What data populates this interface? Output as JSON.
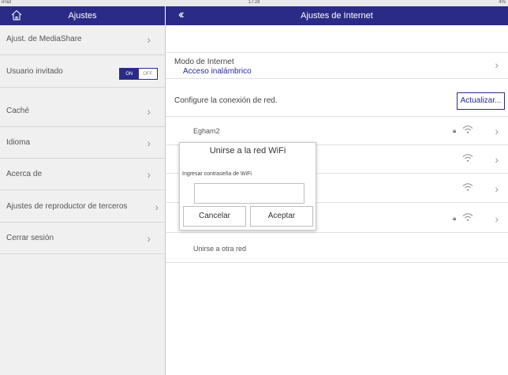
{
  "status_bar": {
    "device": "iPad",
    "time": "17:28",
    "battery": "4%"
  },
  "left_nav": {
    "title": "Ajustes"
  },
  "right_nav": {
    "title": "Ajustes de Internet"
  },
  "sidebar": {
    "items": [
      {
        "label": "Ajust. de MediaShare"
      },
      {
        "label": "Usuario invitado",
        "toggle_on": "ON",
        "toggle_off": "OFF"
      },
      {
        "label": "Caché"
      },
      {
        "label": "Idioma"
      },
      {
        "label": "Acerca de"
      },
      {
        "label": "Ajustes de reproductor de terceros"
      },
      {
        "label": "Cerrar sesión"
      }
    ]
  },
  "internet": {
    "mode_label": "Modo de Internet",
    "mode_value": "Acceso inalámbrico",
    "config_label": "Configure la conexión de red.",
    "refresh_label": "Actualizar...",
    "networks": [
      {
        "name": "Egham2",
        "locked": true
      },
      {
        "name": "",
        "locked": false
      },
      {
        "name": "",
        "locked": false
      },
      {
        "name": "",
        "locked": true
      }
    ],
    "other_network": "Unirse a otra red"
  },
  "dialog": {
    "title": "Unirse a la red WiFi",
    "password_label": "Ingresar contraseña de WiFi",
    "password_value": "",
    "cancel_label": "Cancelar",
    "accept_label": "Aceptar"
  },
  "colors": {
    "accent": "#2b2b87",
    "link": "#2a2a96"
  }
}
